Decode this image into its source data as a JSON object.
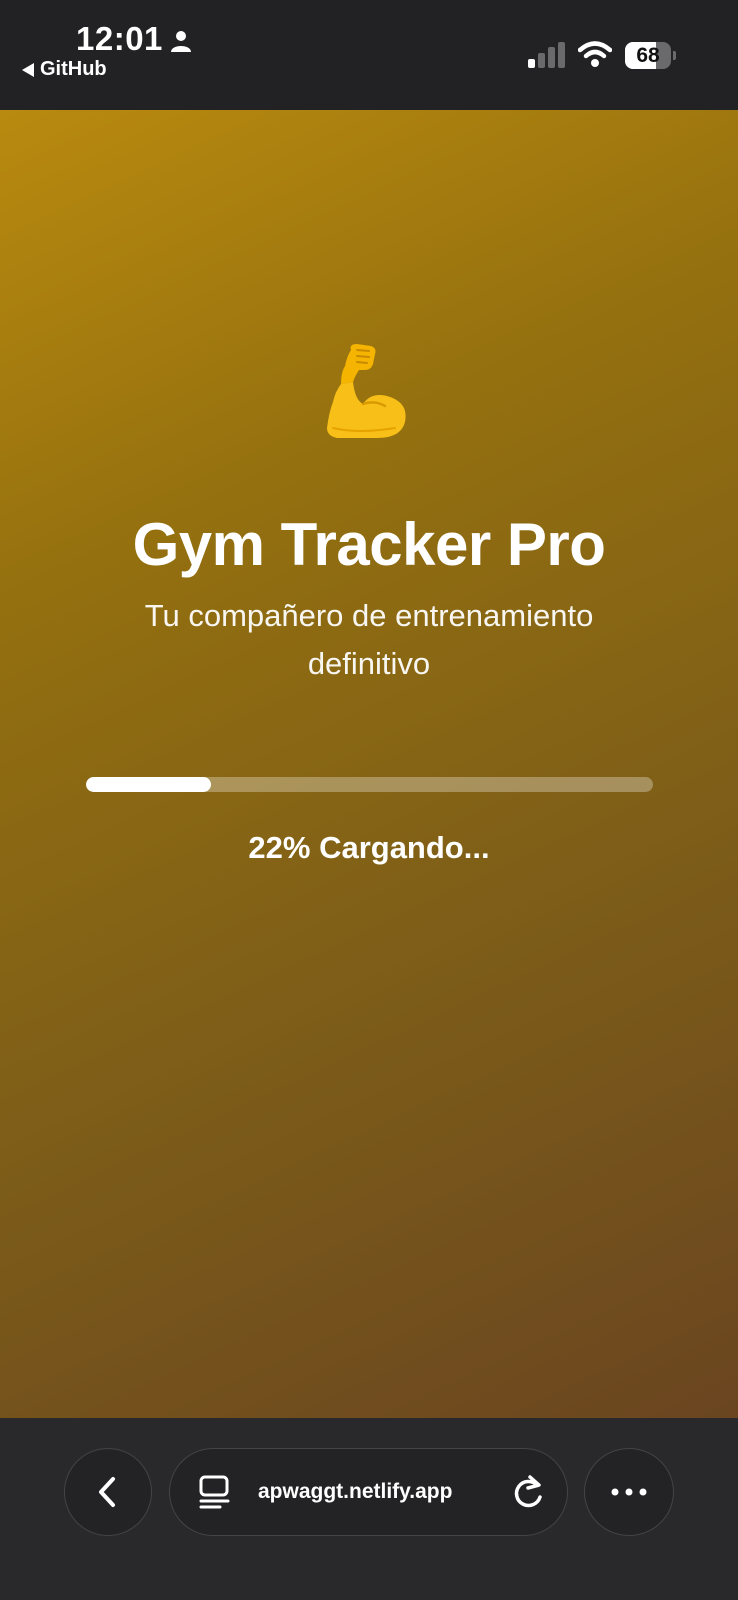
{
  "status_bar": {
    "time": "12:01",
    "back_app_label": "GitHub",
    "battery_level": "68",
    "battery_fraction": 0.68,
    "icons": [
      "person-icon",
      "cellular-signal-icon",
      "wifi-icon",
      "battery-icon"
    ]
  },
  "splash": {
    "icon": "flexed-biceps-icon",
    "title": "Gym Tracker Pro",
    "subtitle": "Tu compañero de entrenamiento definitivo",
    "progress_fraction": 0.22,
    "progress_label": "22% Cargando..."
  },
  "browser_toolbar": {
    "url": "apwaggt.netlify.app",
    "icons": [
      "back-chevron-icon",
      "tabs-icon",
      "reload-icon",
      "more-icon"
    ]
  },
  "colors": {
    "gradient_start": "#b98a0f",
    "gradient_end": "#6a4520",
    "chrome_background": "#222224",
    "progress_fill": "#ffffff"
  }
}
